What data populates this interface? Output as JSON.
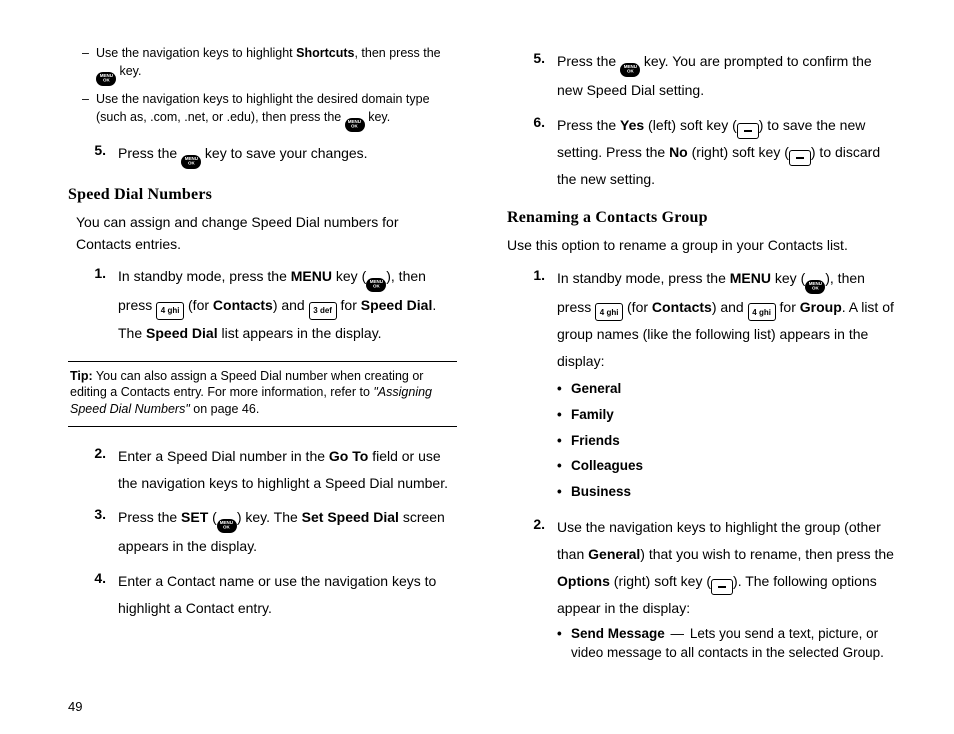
{
  "page_number": "49",
  "icons": {
    "menu": "MENU\nOK",
    "key4": "4 ghi",
    "key3": "3 def"
  },
  "left": {
    "sub_dashes": [
      {
        "pre": "Use the navigation keys to highlight ",
        "bold": "Shortcuts",
        "post1": ", then press the ",
        "post2": " key."
      },
      {
        "pre": "Use the navigation keys to highlight the desired domain type (such as, .com, .net, or .edu), then press the ",
        "bold": "",
        "post1": "",
        "post2": " key."
      }
    ],
    "step5": {
      "num": "5.",
      "pre": "Press the ",
      "post": " key to save your changes."
    },
    "h2": "Speed Dial Numbers",
    "intro": "You can assign and change Speed Dial numbers for Contacts entries.",
    "step1": {
      "num": "1.",
      "a": "In standby mode, press the ",
      "menu": "MENU",
      "b": " key (",
      "c": "), then press ",
      "d": " (for ",
      "contacts": "Contacts",
      "e": ") and ",
      "f": " for ",
      "speeddial": "Speed Dial",
      "g": ". The ",
      "speeddial2": "Speed Dial",
      "h": " list appears in the display."
    },
    "tip": {
      "lead": "Tip:",
      "body1": " You can also assign a Speed Dial number when creating or editing a Contacts entry. For more information, refer to ",
      "ref": "\"Assigning Speed Dial Numbers\"",
      "body2": "  on page 46."
    },
    "step2": {
      "num": "2.",
      "a": "Enter a Speed Dial number in the ",
      "goto": "Go To",
      "b": " field or use the navigation keys to highlight a Speed Dial number."
    },
    "step3": {
      "num": "3.",
      "a": "Press the ",
      "set": "SET",
      "b": " (",
      "c": ") key. The ",
      "ssd": "Set Speed Dial",
      "d": " screen appears in the display."
    },
    "step4": {
      "num": "4.",
      "a": "Enter a Contact name or use the navigation keys to highlight a Contact entry."
    }
  },
  "right": {
    "step5": {
      "num": "5.",
      "a": "Press the ",
      "b": " key. You are prompted to confirm the new Speed Dial setting."
    },
    "step6": {
      "num": "6.",
      "a": "Press the ",
      "yes": "Yes",
      "b": " (left) soft key (",
      "c": ") to save the new setting. Press the ",
      "no": "No",
      "d": " (right) soft key (",
      "e": ") to discard the new setting."
    },
    "h2": "Renaming a Contacts Group",
    "intro": "Use this option to rename a group in your Contacts list.",
    "step1": {
      "num": "1.",
      "a": "In standby mode, press the ",
      "menu": "MENU",
      "b": " key (",
      "c": "), then press ",
      "d": " (for ",
      "contacts": "Contacts",
      "e": ") and ",
      "f": " for ",
      "group": "Group",
      "g": ". A list of group names (like the following list) appears in the display:"
    },
    "groups": [
      "General",
      "Family",
      "Friends",
      "Colleagues",
      "Business"
    ],
    "step2": {
      "num": "2.",
      "a": "Use the navigation keys to highlight the group (other than ",
      "general": "General",
      "b": ") that you wish to rename, then press the ",
      "options": "Options",
      "c": " (right) soft key (",
      "d": "). The following options appear in the display:"
    },
    "opt_send": {
      "label": "Send Message",
      "dash": " — ",
      "desc": "Lets you send a text, picture, or video message to all contacts in the selected Group."
    }
  }
}
